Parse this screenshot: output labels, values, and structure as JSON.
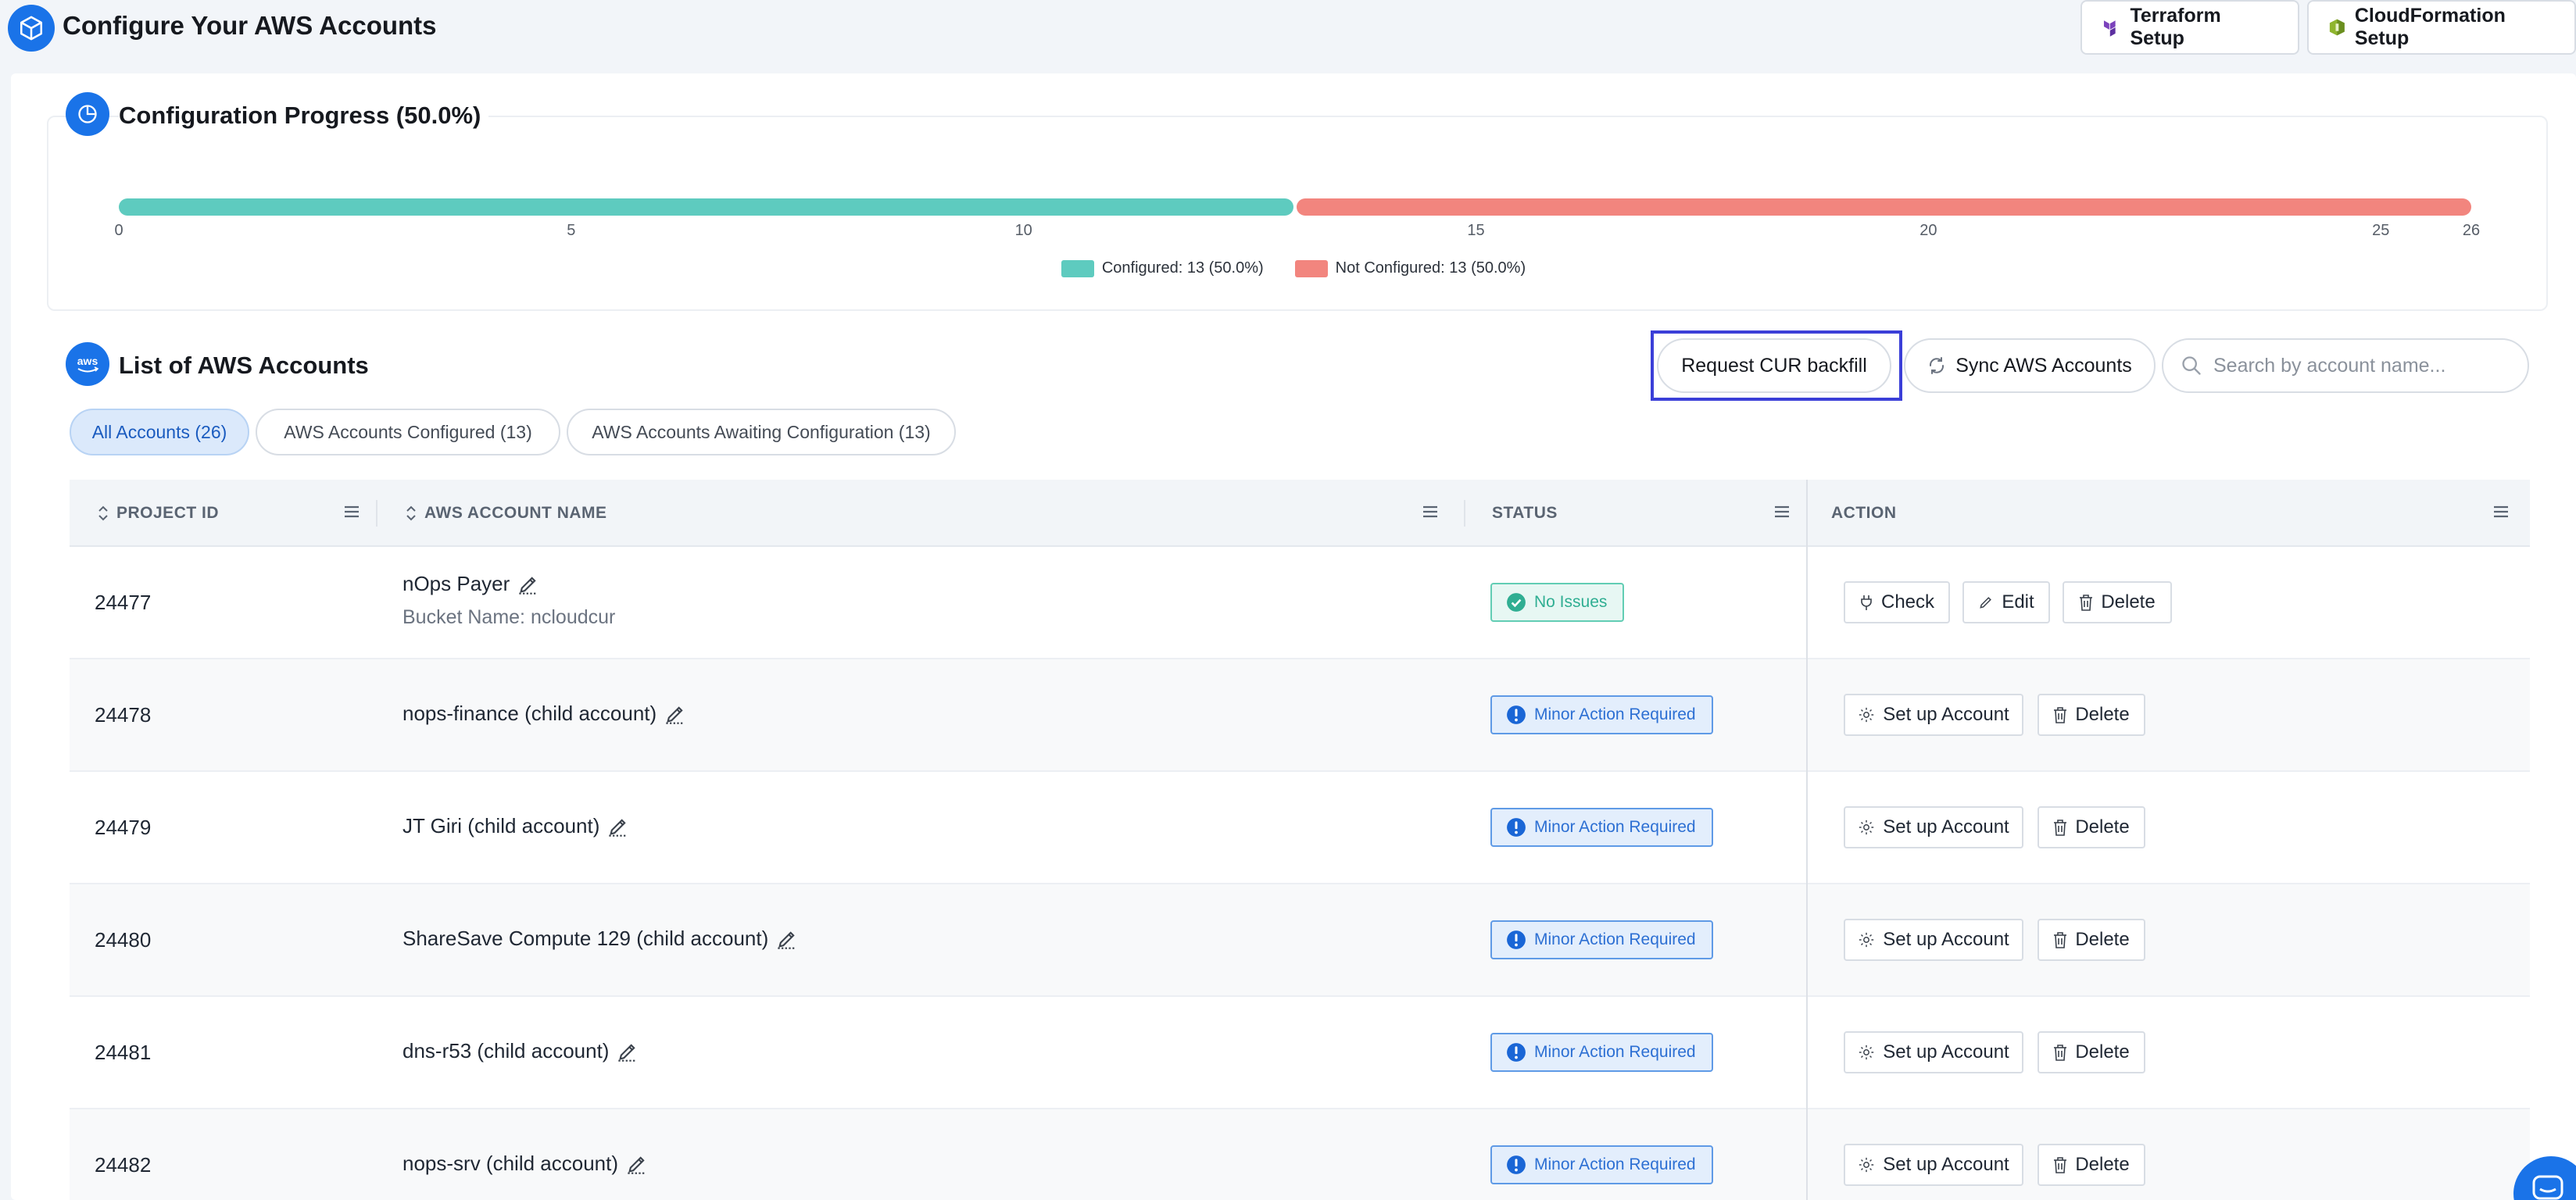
{
  "header": {
    "title": "Configure Your AWS Accounts",
    "terraform_label": "Terraform Setup",
    "cloudformation_label": "CloudFormation Setup"
  },
  "progress": {
    "title": "Configuration Progress (50.0%)",
    "total": 26,
    "configured": 13,
    "not_configured": 13,
    "ticks": [
      "0",
      "5",
      "10",
      "15",
      "20",
      "25",
      "26"
    ],
    "legend_configured": "Configured: 13 (50.0%)",
    "legend_not_configured": "Not Configured: 13 (50.0%)",
    "color_configured": "#5ecbbf",
    "color_not_configured": "#f2857e"
  },
  "accounts": {
    "title": "List of AWS Accounts",
    "request_cur_label": "Request CUR backfill",
    "sync_label": "Sync AWS Accounts",
    "search_placeholder": "Search by account name...",
    "filters": [
      "All Accounts (26)",
      "AWS Accounts Configured (13)",
      "AWS Accounts Awaiting Configuration (13)"
    ],
    "columns": [
      "PROJECT ID",
      "AWS ACCOUNT NAME",
      "STATUS",
      "ACTION"
    ],
    "rows": [
      {
        "id": "24477",
        "name": "nOps Payer",
        "bucket": "Bucket Name: ncloudcur",
        "status": "No Issues",
        "actions": [
          "Check",
          "Edit",
          "Delete"
        ]
      },
      {
        "id": "24478",
        "name": "nops-finance (child account)",
        "status": "Minor Action Required",
        "actions": [
          "Set up Account",
          "Delete"
        ]
      },
      {
        "id": "24479",
        "name": "JT Giri (child account)",
        "status": "Minor Action Required",
        "actions": [
          "Set up Account",
          "Delete"
        ]
      },
      {
        "id": "24480",
        "name": "ShareSave Compute 129 (child account)",
        "status": "Minor Action Required",
        "actions": [
          "Set up Account",
          "Delete"
        ]
      },
      {
        "id": "24481",
        "name": "dns-r53 (child account)",
        "status": "Minor Action Required",
        "actions": [
          "Set up Account",
          "Delete"
        ]
      },
      {
        "id": "24482",
        "name": "nops-srv (child account)",
        "status": "Minor Action Required",
        "actions": [
          "Set up Account",
          "Delete"
        ]
      }
    ]
  },
  "colors": {
    "accent": "#1a73e8",
    "highlight_border": "#3b3fd8",
    "status_ok": "#2fae92",
    "status_warn": "#2c6fd3"
  }
}
